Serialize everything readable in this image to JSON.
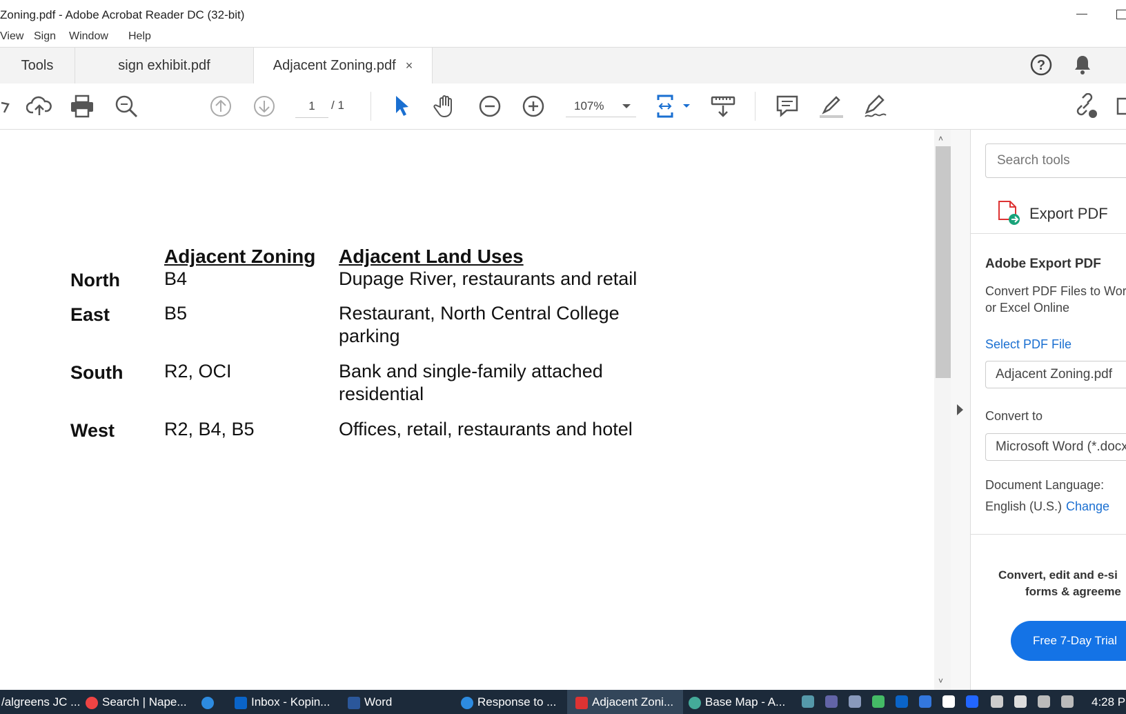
{
  "window": {
    "title": "Zoning.pdf - Adobe Acrobat Reader DC (32-bit)"
  },
  "menu": {
    "items": [
      "View",
      "Sign",
      "Window",
      "Help"
    ]
  },
  "tabs": {
    "tools": "Tools",
    "sign_exhibit": "sign exhibit.pdf",
    "adjacent": "Adjacent Zoning.pdf",
    "close": "×"
  },
  "toolbar": {
    "page_current": "1",
    "page_total": "/ 1",
    "zoom": "107%"
  },
  "document": {
    "headers": {
      "zoning": "Adjacent Zoning",
      "land_uses": "Adjacent Land Uses"
    },
    "rows": [
      {
        "direction": "North",
        "zoning": "B4",
        "uses_line1": "Dupage River, restaurants and retail",
        "uses_line2": ""
      },
      {
        "direction": "East",
        "zoning": "B5",
        "uses_line1": "Restaurant, North Central College",
        "uses_line2": "parking"
      },
      {
        "direction": "South",
        "zoning": "R2, OCI",
        "uses_line1": "Bank and single-family attached",
        "uses_line2": "residential"
      },
      {
        "direction": "West",
        "zoning": "R2, B4, B5",
        "uses_line1": "Offices, retail, restaurants and hotel",
        "uses_line2": ""
      }
    ]
  },
  "right_panel": {
    "search_placeholder": "Search tools",
    "export_pdf": "Export PDF",
    "section_title": "Adobe Export PDF",
    "desc_line1": "Convert PDF Files to Wor",
    "desc_line2": "or Excel Online",
    "select_file": "Select PDF File",
    "file_name": "Adjacent Zoning.pdf",
    "convert_to_label": "Convert to",
    "convert_to_value": "Microsoft Word (*.docx",
    "doc_language_label": "Document Language:",
    "doc_language_value": "English (U.S.)",
    "change": "Change",
    "promo_line1": "Convert, edit and e-si",
    "promo_line2": "forms & agreeme",
    "trial_button": "Free 7-Day Trial"
  },
  "taskbar": {
    "items": [
      "/algreens JC ...",
      "Search | Nape...",
      "Inbox - Kopin...",
      "Word",
      "Response to ...",
      "Adjacent Zoni...",
      "Base Map - A..."
    ],
    "clock": "4:28 P"
  },
  "colors": {
    "accent": "#1473e6",
    "taskbar": "#1c2a3a",
    "link": "#1a6fd1"
  }
}
